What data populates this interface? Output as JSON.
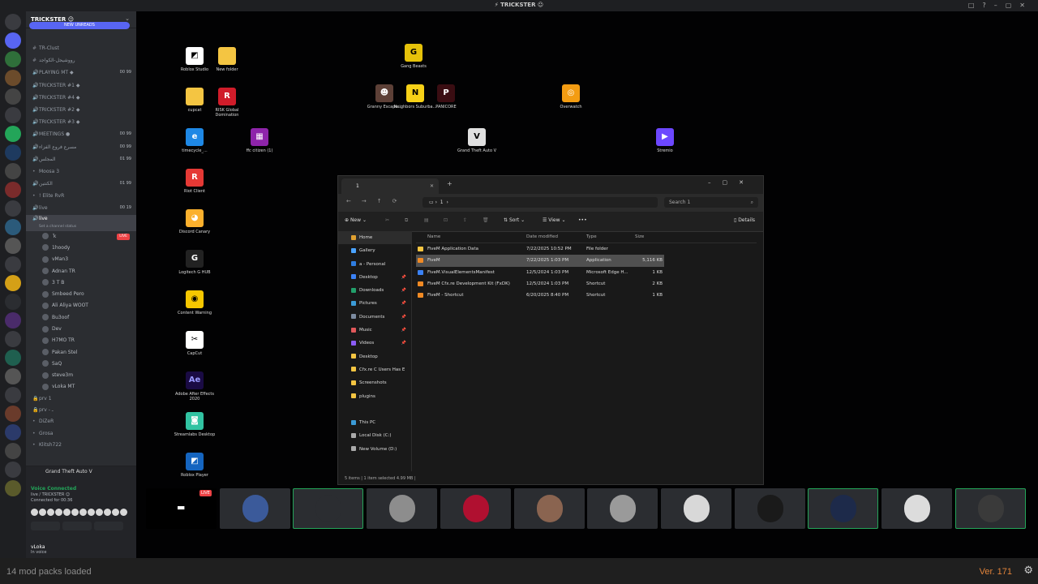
{
  "window": {
    "title": "⚡ TRICKSTER ☺",
    "controls": [
      "□",
      "?",
      "–",
      "▢",
      "✕"
    ]
  },
  "server": {
    "name": "TRICKSTER ☺",
    "new_unreads": "NEW UNREADS"
  },
  "channels": [
    {
      "name": "TR-Clust",
      "icon": "#",
      "count": ""
    },
    {
      "name": "رووشيجل-الكواجد",
      "icon": "#",
      "count": ""
    },
    {
      "name": "PLAYING MT ◆",
      "icon": "🔊",
      "count": "00 99"
    },
    {
      "name": "TRICKSTER #1 ◆",
      "icon": "🔊",
      "count": ""
    },
    {
      "name": "TRICKSTER #4 ◆",
      "icon": "🔊",
      "count": ""
    },
    {
      "name": "TRICKSTER #2 ◆",
      "icon": "🔊",
      "count": ""
    },
    {
      "name": "TRICKSTER #3 ◆",
      "icon": "🔊",
      "count": ""
    },
    {
      "name": "MEETINGS ●",
      "icon": "🔊",
      "count": "00 99"
    },
    {
      "name": "مسرع فروع الفزاء",
      "icon": "🔊",
      "count": "00 99"
    },
    {
      "name": "المجلس",
      "icon": "🔊",
      "count": "01 99"
    },
    {
      "name": "Moosa 3",
      "icon": "•",
      "count": ""
    },
    {
      "name": "الكنتين",
      "icon": "🔊",
      "count": "01 99"
    },
    {
      "name": "! Elite RvR",
      "icon": "•",
      "count": ""
    },
    {
      "name": "live",
      "icon": "🔊",
      "count": "00 19"
    }
  ],
  "active_channel": {
    "name": "live",
    "status": "Set a channel status"
  },
  "voice_users": [
    {
      "name": "ٰ k",
      "live": "LIVE"
    },
    {
      "name": "1hoody",
      "live": ""
    },
    {
      "name": "vMan3",
      "live": ""
    },
    {
      "name": "Adnan TR",
      "live": ""
    },
    {
      "name": "3 T B",
      "live": ""
    },
    {
      "name": "Smbeed Pero",
      "live": ""
    },
    {
      "name": "Ali Aliya WOOT",
      "live": ""
    },
    {
      "name": "Bu3oof",
      "live": ""
    },
    {
      "name": "Dev",
      "live": ""
    },
    {
      "name": "H7MO TR",
      "live": ""
    },
    {
      "name": "Pakan Stel",
      "live": ""
    },
    {
      "name": "SaQ",
      "live": ""
    },
    {
      "name": "steve3m",
      "live": ""
    },
    {
      "name": "vLoka MT",
      "live": ""
    }
  ],
  "extra_channels": [
    {
      "name": "prv 1",
      "icon": "🔒"
    },
    {
      "name": "prv - ـ",
      "icon": "🔒"
    },
    {
      "name": "DiZeR",
      "icon": "•"
    },
    {
      "name": "Grosa",
      "icon": "•"
    },
    {
      "name": "Klitsh722",
      "icon": "•"
    }
  ],
  "voice_panel": {
    "game": "Grand Theft Auto V",
    "status": "Voice Connected",
    "location": "live / TRICKSTER ☺",
    "duration": "Connected for 00:36",
    "user": "vLoka",
    "user_status": "In voice"
  },
  "desktop_icons": [
    {
      "label": "Roblox Studio",
      "glyph": "◩",
      "color": "#ffffff",
      "text": "#000000"
    },
    {
      "label": "New folder",
      "glyph": "",
      "color": "#f4c542",
      "text": "#000000"
    },
    {
      "label": "Gang Beasts",
      "glyph": "G",
      "color": "#e6c20a",
      "text": "#000000"
    },
    {
      "label": "cupcat",
      "glyph": "",
      "color": "#f4c542",
      "text": "#000000"
    },
    {
      "label": "RISK Global Domination",
      "glyph": "R",
      "color": "#d01c2a",
      "text": "#ffffff"
    },
    {
      "label": "Granny Escape...",
      "glyph": "☻",
      "color": "#5d4037",
      "text": "#ffffff"
    },
    {
      "label": "Neighbors Suburba...",
      "glyph": "N",
      "color": "#f7d117",
      "text": "#000000"
    },
    {
      "label": "PANICORE",
      "glyph": "P",
      "color": "#3a0d12",
      "text": "#ffffff"
    },
    {
      "label": "Overwatch",
      "glyph": "◎",
      "color": "#f39c12",
      "text": "#ffffff"
    },
    {
      "label": "timecycle_...",
      "glyph": "e",
      "color": "#1e88e5",
      "text": "#ffffff"
    },
    {
      "label": "ffc citizen (1)",
      "glyph": "▦",
      "color": "#8e24aa",
      "text": "#ffffff"
    },
    {
      "label": "Grand Theft Auto V",
      "glyph": "V",
      "color": "#e0e0e0",
      "text": "#000000"
    },
    {
      "label": "Stremio",
      "glyph": "▶",
      "color": "#6c47ff",
      "text": "#ffffff"
    },
    {
      "label": "Riot Client",
      "glyph": "R",
      "color": "#e53935",
      "text": "#ffffff"
    },
    {
      "label": "Discord Canary",
      "glyph": "◕",
      "color": "#fbb02d",
      "text": "#ffffff"
    },
    {
      "label": "Logitech G HUB",
      "glyph": "G",
      "color": "#222222",
      "text": "#ffffff"
    },
    {
      "label": "Content Warning",
      "glyph": "◉",
      "color": "#f6c700",
      "text": "#000000"
    },
    {
      "label": "CapCut",
      "glyph": "✂",
      "color": "#ffffff",
      "text": "#000000"
    },
    {
      "label": "Adobe After Effects 2020",
      "glyph": "Ae",
      "color": "#1a0b44",
      "text": "#9999ff"
    },
    {
      "label": "Streamlabs Desktop",
      "glyph": "◙",
      "color": "#31c3a2",
      "text": "#ffffff"
    },
    {
      "label": "Roblox Player",
      "glyph": "◩",
      "color": "#1565c0",
      "text": "#ffffff"
    }
  ],
  "explorer": {
    "tab": "1",
    "path": "1",
    "search_placeholder": "Search 1",
    "toolbar": {
      "new": "New",
      "sort": "Sort",
      "view": "View",
      "more": "•••",
      "details": "Details"
    },
    "nav": [
      {
        "label": "Home",
        "pin": "",
        "color": "#e0a030"
      },
      {
        "label": "Gallery",
        "pin": "",
        "color": "#4aa3ff"
      },
      {
        "label": "a - Personal",
        "pin": "",
        "color": "#2f7de1"
      },
      {
        "label": "Desktop",
        "pin": "📌",
        "color": "#3b82f6"
      },
      {
        "label": "Downloads",
        "pin": "📌",
        "color": "#22a06b"
      },
      {
        "label": "Pictures",
        "pin": "📌",
        "color": "#3b9bd6"
      },
      {
        "label": "Documents",
        "pin": "📌",
        "color": "#7c8ba0"
      },
      {
        "label": "Music",
        "pin": "📌",
        "color": "#e0585a"
      },
      {
        "label": "Videos",
        "pin": "📌",
        "color": "#8b5cf6"
      },
      {
        "label": "Desktop",
        "pin": "",
        "color": "#f4c542"
      },
      {
        "label": "Cfx.re C Users Has E",
        "pin": "",
        "color": "#f4c542"
      },
      {
        "label": "Screenshots",
        "pin": "",
        "color": "#f4c542"
      },
      {
        "label": "plugins",
        "pin": "",
        "color": "#f4c542"
      },
      {
        "label": "",
        "pin": "",
        "color": ""
      },
      {
        "label": "This PC",
        "pin": "",
        "color": "#3b9bd6"
      },
      {
        "label": "Local Disk (C:)",
        "pin": "",
        "color": "#aaaaaa"
      },
      {
        "label": "New Volume (D:)",
        "pin": "",
        "color": "#aaaaaa"
      }
    ],
    "columns": [
      "Name",
      "Date modified",
      "Type",
      "Size"
    ],
    "files": [
      {
        "name": "FiveM Application Data",
        "date": "7/22/2025 10:52 PM",
        "type": "File folder",
        "size": "",
        "color": "#f4c542",
        "selected": false
      },
      {
        "name": "FiveM",
        "date": "7/22/2025 1:03 PM",
        "type": "Application",
        "size": "5,116 KB",
        "color": "#f08a24",
        "selected": true
      },
      {
        "name": "FiveM.VisualElementsManifest",
        "date": "12/5/2024 1:03 PM",
        "type": "Microsoft Edge H...",
        "size": "1 KB",
        "color": "#3b82f6",
        "selected": false
      },
      {
        "name": "FiveM Cfx.re Development Kit (FxDK)",
        "date": "12/5/2024 1:03 PM",
        "type": "Shortcut",
        "size": "2 KB",
        "color": "#f08a24",
        "selected": false
      },
      {
        "name": "FiveM - Shortcut",
        "date": "6/20/2025 8:40 PM",
        "type": "Shortcut",
        "size": "1 KB",
        "color": "#f08a24",
        "selected": false
      }
    ],
    "status": "5 items  |  1 item selected  4.99 MB  |"
  },
  "stage_tiles": [
    {
      "label": "screen",
      "color": "#111111",
      "speaking": false,
      "live": "LIVE"
    },
    {
      "label": "avatar",
      "color": "#3b5a9a",
      "speaking": false,
      "live": ""
    },
    {
      "label": "avatar",
      "color": "#2b2d31",
      "speaking": true,
      "live": ""
    },
    {
      "label": "avatar",
      "color": "#8d8d8d",
      "speaking": false,
      "live": ""
    },
    {
      "label": "avatar",
      "color": "#b01030",
      "speaking": false,
      "live": ""
    },
    {
      "label": "avatar",
      "color": "#8a6450",
      "speaking": false,
      "live": ""
    },
    {
      "label": "avatar",
      "color": "#9a9a9a",
      "speaking": false,
      "live": ""
    },
    {
      "label": "avatar",
      "color": "#d8d8d8",
      "speaking": false,
      "live": ""
    },
    {
      "label": "avatar",
      "color": "#1a1a1a",
      "speaking": false,
      "live": ""
    },
    {
      "label": "avatar",
      "color": "#1d2a4a",
      "speaking": true,
      "live": ""
    },
    {
      "label": "avatar",
      "color": "#dcdcdc",
      "speaking": false,
      "live": ""
    },
    {
      "label": "avatar",
      "color": "#3a3a3a",
      "speaking": true,
      "live": ""
    }
  ],
  "bottom_bar": {
    "mods": "14 mod packs loaded",
    "version": "Ver. 171",
    "gear": "⚙"
  }
}
